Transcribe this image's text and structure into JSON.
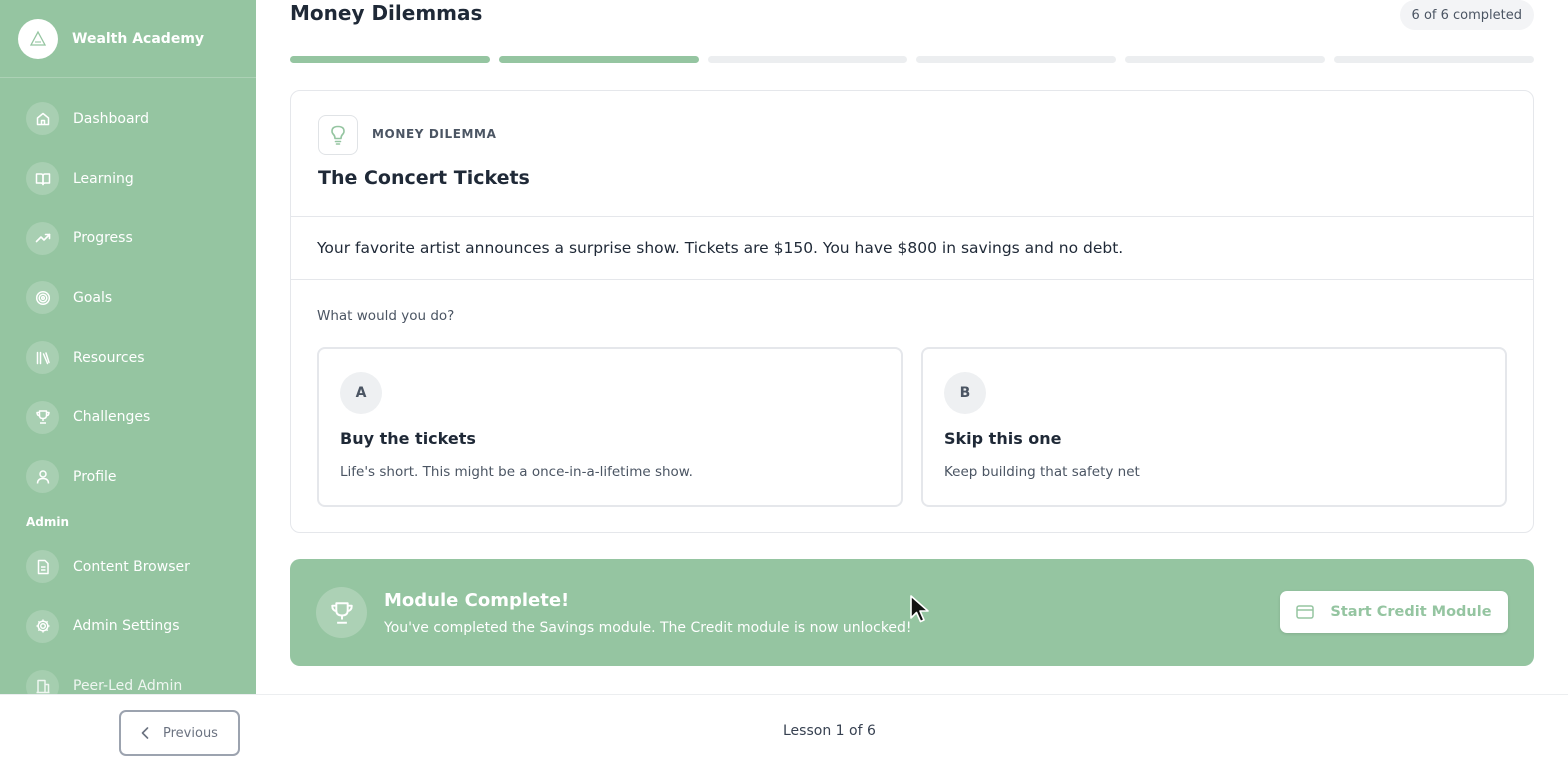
{
  "sidebar": {
    "brand": "Wealth Academy",
    "items": [
      {
        "label": "Dashboard",
        "icon": "home-icon"
      },
      {
        "label": "Learning",
        "icon": "book-icon"
      },
      {
        "label": "Progress",
        "icon": "trending-up-icon"
      },
      {
        "label": "Goals",
        "icon": "target-icon"
      },
      {
        "label": "Resources",
        "icon": "library-icon"
      },
      {
        "label": "Challenges",
        "icon": "trophy-icon"
      },
      {
        "label": "Profile",
        "icon": "user-icon"
      }
    ],
    "admin_heading": "Admin",
    "admin_items": [
      {
        "label": "Content Browser",
        "icon": "file-text-icon"
      },
      {
        "label": "Admin Settings",
        "icon": "gear-icon"
      },
      {
        "label": "Peer-Led Admin",
        "icon": "building-icon"
      }
    ]
  },
  "header": {
    "title": "Money Dilemmas",
    "completed": "6 of 6 completed"
  },
  "progress": {
    "segments_total": 6,
    "segments_done": 2
  },
  "dilemma": {
    "tag": "MONEY DILEMMA",
    "title": "The Concert Tickets",
    "scenario": "Your favorite artist announces a surprise show. Tickets are $150. You have $800 in savings and no debt.",
    "question": "What would you do?",
    "options": [
      {
        "letter": "A",
        "title": "Buy the tickets",
        "description": "Life's short. This might be a once-in-a-lifetime show."
      },
      {
        "letter": "B",
        "title": "Skip this one",
        "description": "Keep building that safety net"
      }
    ]
  },
  "module_complete": {
    "title": "Module Complete!",
    "text": "You've completed the Savings module. The Credit module is now unlocked!",
    "button_label": "Start Credit Module"
  },
  "footer": {
    "previous_label": "Previous",
    "lesson_info": "Lesson 1 of 6"
  },
  "colors": {
    "accent": "#95c5a1",
    "text": "#1f2937",
    "muted": "#4b5563",
    "border": "#e5e7eb"
  }
}
